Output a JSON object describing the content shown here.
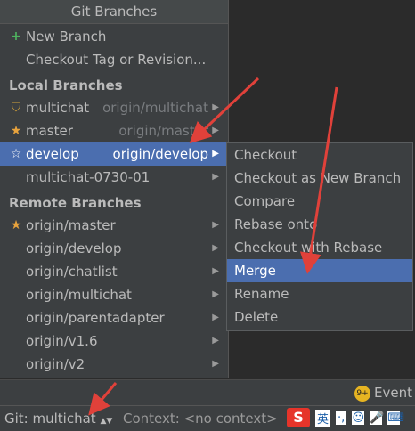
{
  "popup": {
    "title": "Git Branches",
    "actions": [
      {
        "label": "New Branch",
        "icon": "plus-icon"
      },
      {
        "label": "Checkout Tag or Revision..."
      }
    ],
    "local_header": "Local Branches",
    "local": [
      {
        "label": "multichat",
        "remote": "origin/multichat",
        "icon": "tag-icon"
      },
      {
        "label": "master",
        "remote": "origin/master",
        "icon": "star-icon"
      },
      {
        "label": "develop",
        "remote": "origin/develop",
        "icon": "star-outline-icon",
        "selected": true
      },
      {
        "label": "multichat-0730-01",
        "remote": ""
      }
    ],
    "remote_header": "Remote Branches",
    "remote": [
      {
        "label": "origin/master",
        "icon": "star-icon"
      },
      {
        "label": "origin/develop"
      },
      {
        "label": "origin/chatlist"
      },
      {
        "label": "origin/multichat"
      },
      {
        "label": "origin/parentadapter"
      },
      {
        "label": "origin/v1.6"
      },
      {
        "label": "origin/v2"
      }
    ]
  },
  "submenu": {
    "items": [
      "Checkout",
      "Checkout as New Branch",
      "Compare",
      "Rebase onto",
      "Checkout with Rebase",
      "Merge",
      "Rename",
      "Delete"
    ],
    "selected_index": 5
  },
  "event_log": {
    "badge": "9+",
    "label": "Event L"
  },
  "statusbar": {
    "git": "Git: multichat",
    "context": "Context: <no context>"
  },
  "ime": {
    "logo": "S",
    "lang": "英",
    "punct": "·,"
  },
  "colors": {
    "selection": "#4b6eaf",
    "annotation_arrow": "#e0413a"
  }
}
